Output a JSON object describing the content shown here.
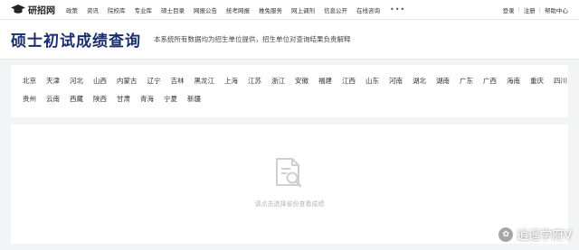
{
  "nav": {
    "logo_text": "研招网",
    "items": [
      "政策",
      "资讯",
      "院校库",
      "专业库",
      "硕士目录",
      "网报公告",
      "统考网报",
      "推免服务",
      "网上调剂",
      "信息公开",
      "在线咨询"
    ],
    "more": "•••",
    "user_links": [
      "登录",
      "注册",
      "帮助中心"
    ]
  },
  "header": {
    "title": "硕士初试成绩查询",
    "description": "本系统所有数据均为招生单位提供，招生单位对查询结果负责解释"
  },
  "regions": {
    "row1": [
      "北京",
      "天津",
      "河北",
      "山西",
      "内蒙古",
      "辽宁",
      "吉林",
      "黑龙江",
      "上海",
      "江苏",
      "浙江",
      "安徽",
      "福建",
      "江西",
      "山东",
      "河南",
      "湖北",
      "湖南",
      "广东",
      "广西",
      "海南",
      "重庆",
      "四川"
    ],
    "row2": [
      "贵州",
      "云南",
      "西藏",
      "陕西",
      "甘肃",
      "青海",
      "宁夏",
      "新疆"
    ]
  },
  "empty_state": {
    "text": "请点击选择省份查看成绩",
    "icon": "document-search-icon"
  },
  "watermark": {
    "text": "逍遥学府V"
  }
}
